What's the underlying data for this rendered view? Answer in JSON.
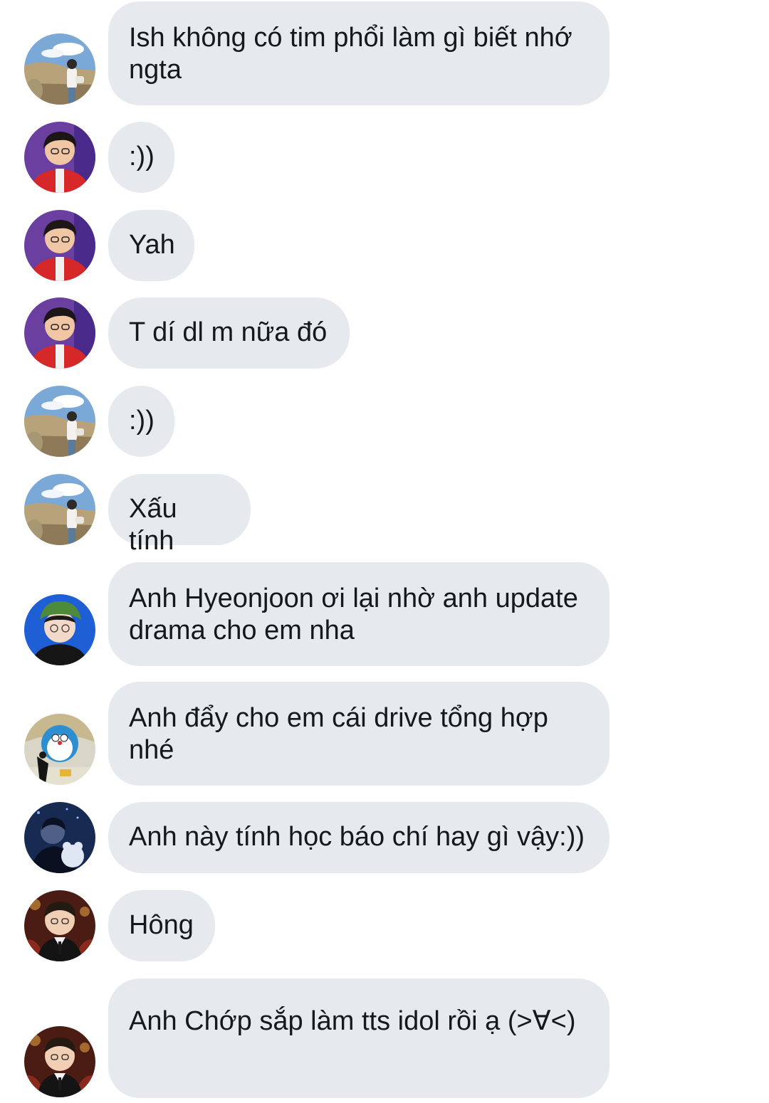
{
  "messages": [
    {
      "avatar": "landscape-avatar-icon",
      "text": "Ish không có tim phổi làm gì biết nhớ ngta"
    },
    {
      "avatar": "red-jacket-avatar-icon",
      "text": ":))"
    },
    {
      "avatar": "red-jacket-avatar-icon",
      "text": "Yah"
    },
    {
      "avatar": "red-jacket-avatar-icon",
      "text": "T dí dl m nữa đó"
    },
    {
      "avatar": "landscape-avatar-icon",
      "text": ":))"
    },
    {
      "avatar": "landscape-avatar-icon",
      "text": "Xấu tính"
    },
    {
      "avatar": "green-hat-avatar-icon",
      "text": "Anh Hyeonjoon ơi lại nhờ anh update drama cho em nha"
    },
    {
      "avatar": "doraemon-avatar-icon",
      "text": "Anh đẩy cho em cái drive tổng hợp nhé"
    },
    {
      "avatar": "night-plush-avatar-icon",
      "text": "Anh này tính học báo chí hay gì vậy:))"
    },
    {
      "avatar": "suit-avatar-icon",
      "text": "Hông"
    },
    {
      "avatar": "suit-avatar-icon",
      "text": "Anh Chớp sắp làm tts idol rồi ạ (>∀<)"
    }
  ]
}
